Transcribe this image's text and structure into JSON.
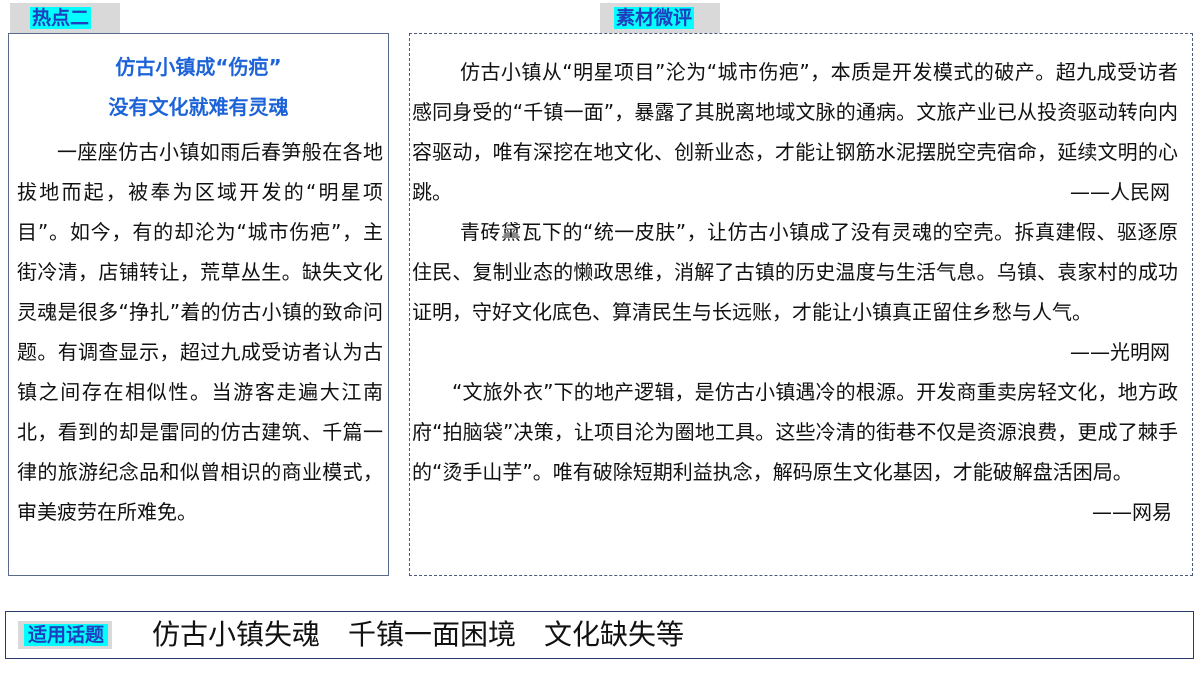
{
  "left_section": {
    "tab_label": "热点二",
    "title_line1": "仿古小镇成“伤疤”",
    "title_line2": "没有文化就难有灵魂",
    "body": "一座座仿古小镇如雨后春笋般在各地拔地而起，被奉为区域开发的“明星项目”。如今，有的却沦为“城市伤疤”，主街冷清，店铺转让，荒草丛生。缺失文化灵魂是很多“挣扎”着的仿古小镇的致命问题。有调查显示，超过九成受访者认为古镇之间存在相似性。当游客走遍大江南北，看到的却是雷同的仿古建筑、千篇一律的旅游纪念品和似曾相识的商业模式，审美疲劳在所难免。"
  },
  "right_section": {
    "tab_label": "素材微评",
    "paragraphs": [
      {
        "text": "仿古小镇从“明星项目”沦为“城市伤疤”，本质是开发模式的破产。超九成受访者感同身受的“千镇一面”，暴露了其脱离地域文脉的通病。文旅产业已从投资驱动转向内容驱动，唯有深挖在地文化、创新业态，才能让钢筋水泥摆脱空壳宿命，延续文明的心跳。",
        "source": "——人民网"
      },
      {
        "text": "青砖黛瓦下的“统一皮肤”，让仿古小镇成了没有灵魂的空壳。拆真建假、驱逐原住民、复制业态的懒政思维，消解了古镇的历史温度与生活气息。乌镇、袁家村的成功证明，守好文化底色、算清民生与长远账，才能让小镇真正留住乡愁与人气。",
        "source": "——光明网"
      },
      {
        "text": "“文旅外衣”下的地产逻辑，是仿古小镇遇冷的根源。开发商重卖房轻文化，地方政府“拍脑袋”决策，让项目沦为圈地工具。这些冷清的街巷不仅是资源浪费，更成了棘手的“烫手山芋”。唯有破除短期利益执念，解码原生文化基因，才能破解盘活困局。",
        "source": "——网易"
      }
    ]
  },
  "topics": {
    "label": "适用话题",
    "text": "仿古小镇失魂　千镇一面困境　文化缺失等"
  },
  "colors": {
    "label_highlight": "#00ffff",
    "label_text": "#1f3fbf",
    "title_blue": "#1d63d8",
    "label_bg": "#d9d9d9"
  }
}
